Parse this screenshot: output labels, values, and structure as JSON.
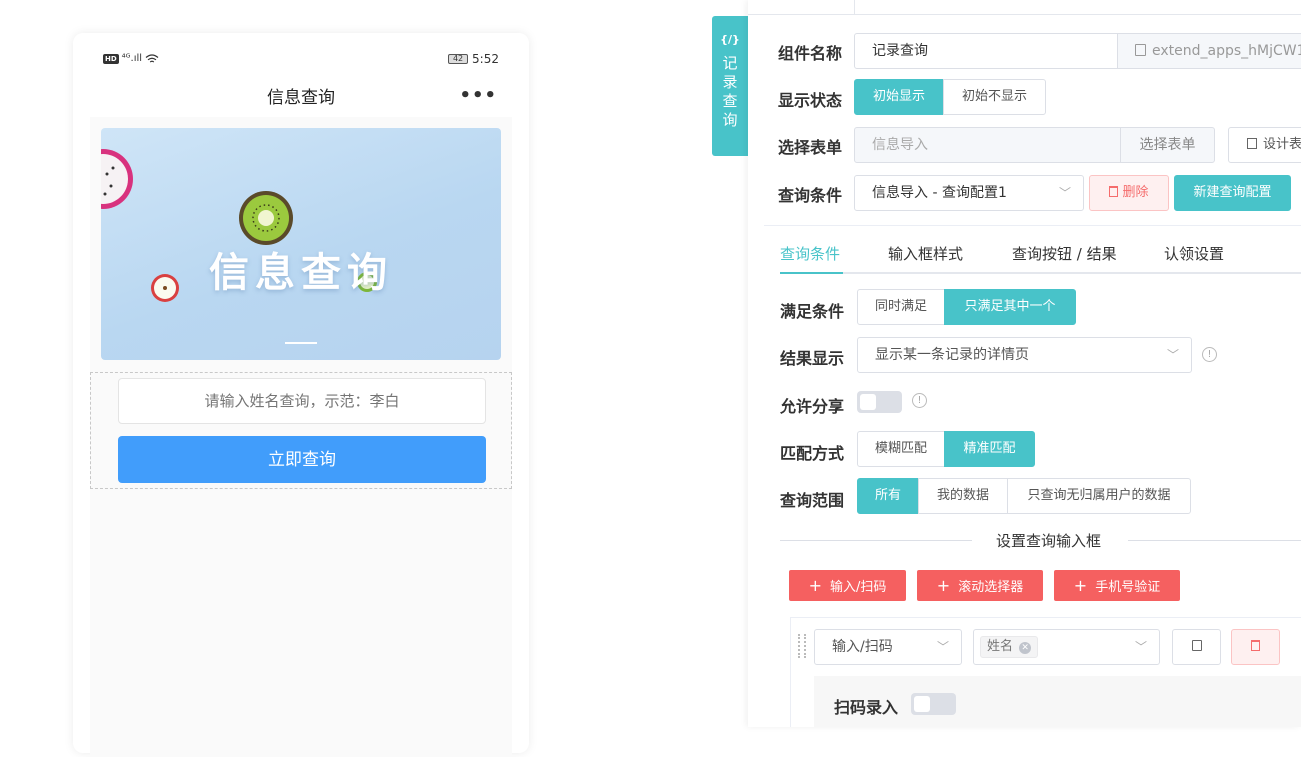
{
  "phone": {
    "status_time": "5:52",
    "status_battery": "42",
    "status_signal": "⁴ᴳ.ıll",
    "status_hd": "HD",
    "title": "信息查询",
    "more": "•••",
    "banner_title": "信息查询",
    "search_placeholder": "请输入姓名查询，示范：李白",
    "search_button": "立即查询"
  },
  "vertical_tab": {
    "icon": "{/}",
    "label": "记录查询"
  },
  "panel": {
    "component_name_label": "组件名称",
    "component_name_value": "记录查询",
    "component_id": "extend_apps_hMjCW1",
    "display_status_label": "显示状态",
    "display_status_options": [
      "初始显示",
      "初始不显示"
    ],
    "select_form_label": "选择表单",
    "select_form_value": "信息导入",
    "select_form_button": "选择表单",
    "design_form_button": "设计表",
    "query_condition_label": "查询条件",
    "query_condition_value": "信息导入 - 查询配置1",
    "delete_button": "删除",
    "new_config_button": "新建查询配置",
    "tabs": [
      "查询条件",
      "输入框样式",
      "查询按钮 / 结果",
      "认领设置"
    ],
    "satisfy_label": "满足条件",
    "satisfy_options": [
      "同时满足",
      "只满足其中一个"
    ],
    "result_label": "结果显示",
    "result_value": "显示某一条记录的详情页",
    "share_label": "允许分享",
    "match_label": "匹配方式",
    "match_options": [
      "模糊匹配",
      "精准匹配"
    ],
    "scope_label": "查询范围",
    "scope_options": [
      "所有",
      "我的数据",
      "只查询无归属用户的数据"
    ],
    "divider_title": "设置查询输入框",
    "add_buttons": [
      "输入/扫码",
      "滚动选择器",
      "手机号验证"
    ],
    "row_type": "输入/扫码",
    "row_tag": "姓名",
    "scan_label": "扫码录入"
  },
  "colors": {
    "accent": "#48c3c9",
    "blue_button": "#419dfb",
    "red_button": "#f56060"
  }
}
